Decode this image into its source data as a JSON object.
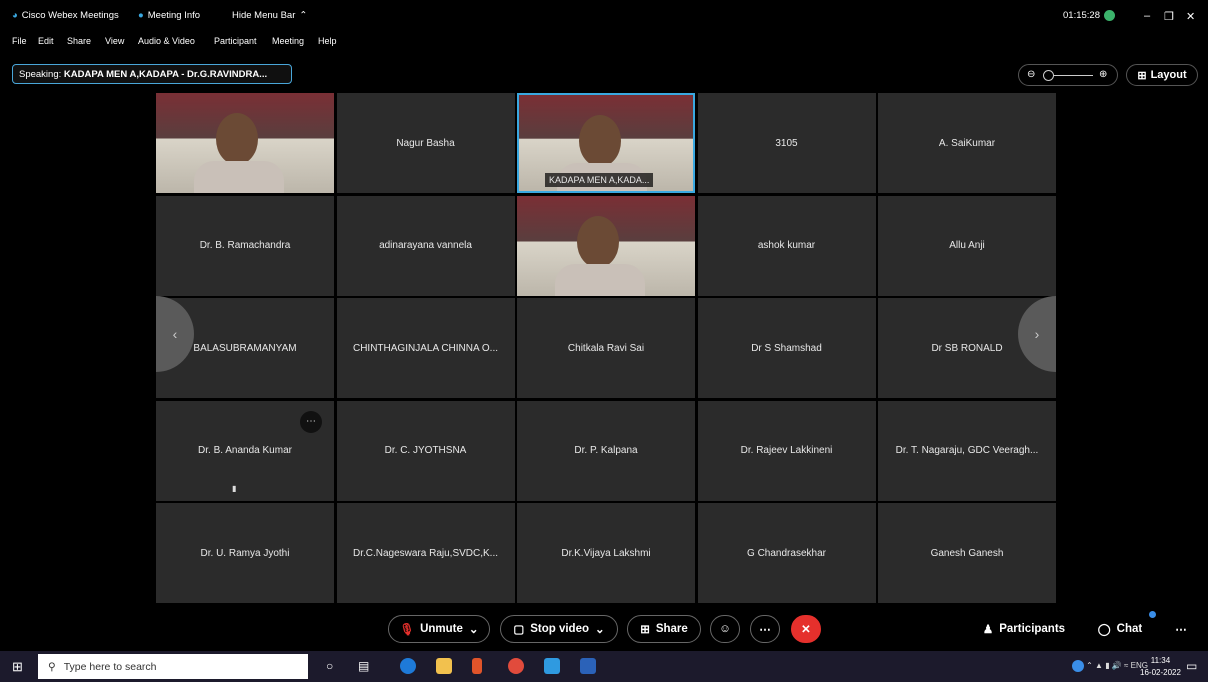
{
  "titlebar": {
    "app_name": "Cisco Webex Meetings",
    "meeting_info": "Meeting Info",
    "hide_menu_bar": "Hide Menu Bar",
    "timer": "01:15:28"
  },
  "menu": [
    "File",
    "Edit",
    "Share",
    "View",
    "Audio & Video",
    "Participant",
    "Meeting",
    "Help"
  ],
  "speaking": {
    "prefix": "Speaking:",
    "name": "KADAPA MEN A,KADAPA - Dr.G.RAVINDRA..."
  },
  "layout_label": "Layout",
  "tiles": [
    {
      "name": "",
      "video": true
    },
    {
      "name": "Nagur Basha"
    },
    {
      "name": "",
      "video": true,
      "active": true,
      "tag": "KADAPA MEN A,KADA..."
    },
    {
      "name": "3105"
    },
    {
      "name": "A. SaiKumar"
    },
    {
      "name": "Dr. B. Ramachandra"
    },
    {
      "name": "adinarayana vannela"
    },
    {
      "name": "",
      "video": true
    },
    {
      "name": "ashok kumar"
    },
    {
      "name": "Allu Anji"
    },
    {
      "name": "BALASUBRAMANYAM"
    },
    {
      "name": "CHINTHAGINJALA CHINNA O..."
    },
    {
      "name": "Chitkala Ravi Sai"
    },
    {
      "name": "Dr S Shamshad"
    },
    {
      "name": "Dr SB RONALD"
    },
    {
      "name": "Dr. B. Ananda Kumar"
    },
    {
      "name": "Dr. C. JYOTHSNA"
    },
    {
      "name": "Dr. P. Kalpana"
    },
    {
      "name": "Dr. Rajeev Lakkineni"
    },
    {
      "name": "Dr. T. Nagaraju, GDC Veeragh..."
    },
    {
      "name": "Dr. U. Ramya Jyothi"
    },
    {
      "name": "Dr.C.Nageswara Raju,SVDC,K..."
    },
    {
      "name": "Dr.K.Vijaya Lakshmi"
    },
    {
      "name": "G Chandrasekhar"
    },
    {
      "name": "Ganesh Ganesh"
    }
  ],
  "controls": {
    "unmute": "Unmute",
    "stop_video": "Stop video",
    "share": "Share",
    "participants": "Participants",
    "chat": "Chat"
  },
  "taskbar": {
    "search_placeholder": "Type here to search",
    "lang": "ENG",
    "time": "11:34",
    "date": "16-02-2022"
  },
  "colors": {
    "accent": "#3aa8e0",
    "leave": "#e5302c",
    "tile_bg": "#2b2b2b"
  }
}
